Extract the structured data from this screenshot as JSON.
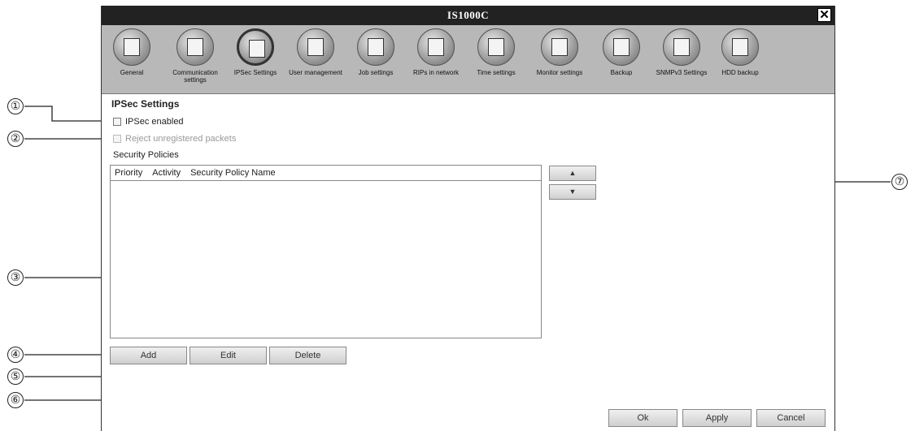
{
  "window": {
    "title": "IS1000C",
    "close_glyph": "✕"
  },
  "toolbar": {
    "items": [
      {
        "label": "General",
        "icon": "printer-icon"
      },
      {
        "label": "Communication settings",
        "icon": "network-computers-icon"
      },
      {
        "label": "IPSec Settings",
        "icon": "ipsec-lock-icon",
        "active": true
      },
      {
        "label": "User management",
        "icon": "users-icon"
      },
      {
        "label": "Job settings",
        "icon": "job-document-icon"
      },
      {
        "label": "RIPs in network",
        "icon": "network-tree-icon"
      },
      {
        "label": "Time settings",
        "icon": "clock-icon"
      },
      {
        "label": "Monitor settings",
        "icon": "monitor-icon"
      },
      {
        "label": "Backup",
        "icon": "backup-disk-icon"
      },
      {
        "label": "SNMPv3 Settings",
        "icon": "snmp-computers-icon"
      },
      {
        "label": "HDD backup",
        "icon": "hdd-icon"
      }
    ]
  },
  "main": {
    "section_title": "IPSec Settings",
    "ipsec_enabled": {
      "label": "IPSec enabled",
      "checked": false
    },
    "reject_unregistered": {
      "label": "Reject unregistered packets",
      "checked": false,
      "disabled": true
    },
    "policies_label": "Security Policies",
    "table_headers": [
      "Priority",
      "Activity",
      "Security Policy Name"
    ],
    "table_rows": [],
    "move_up": "▲",
    "move_down": "▼",
    "add_label": "Add",
    "edit_label": "Edit",
    "delete_label": "Delete"
  },
  "footer": {
    "ok_label": "Ok",
    "apply_label": "Apply",
    "cancel_label": "Cancel"
  },
  "callouts": [
    "①",
    "②",
    "③",
    "④",
    "⑤",
    "⑥",
    "⑦"
  ]
}
